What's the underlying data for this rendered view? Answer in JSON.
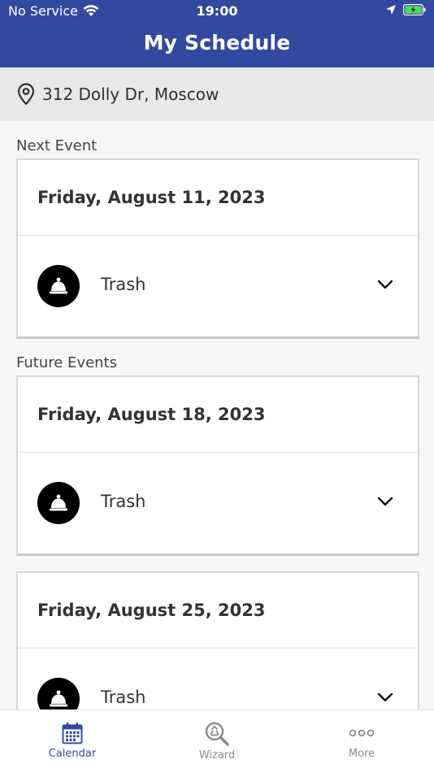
{
  "status_bar": {
    "carrier": "No Service",
    "time": "19:00"
  },
  "header": {
    "title": "My Schedule"
  },
  "location": {
    "address": "312 Dolly Dr, Moscow"
  },
  "sections": {
    "next_label": "Next Event",
    "future_label": "Future Events"
  },
  "events": [
    {
      "date": "Friday, August 11, 2023",
      "item": "Trash"
    },
    {
      "date": "Friday, August 18, 2023",
      "item": "Trash"
    },
    {
      "date": "Friday, August 25, 2023",
      "item": "Trash"
    }
  ],
  "tabbar": {
    "items": [
      {
        "label": "Calendar",
        "icon": "calendar-icon",
        "active": true
      },
      {
        "label": "Wizard",
        "icon": "recycle-search-icon",
        "active": false
      },
      {
        "label": "More",
        "icon": "more-dots-icon",
        "active": false
      }
    ]
  },
  "colors": {
    "brand": "#3349a0",
    "tab_inactive": "#8a8a8a"
  }
}
